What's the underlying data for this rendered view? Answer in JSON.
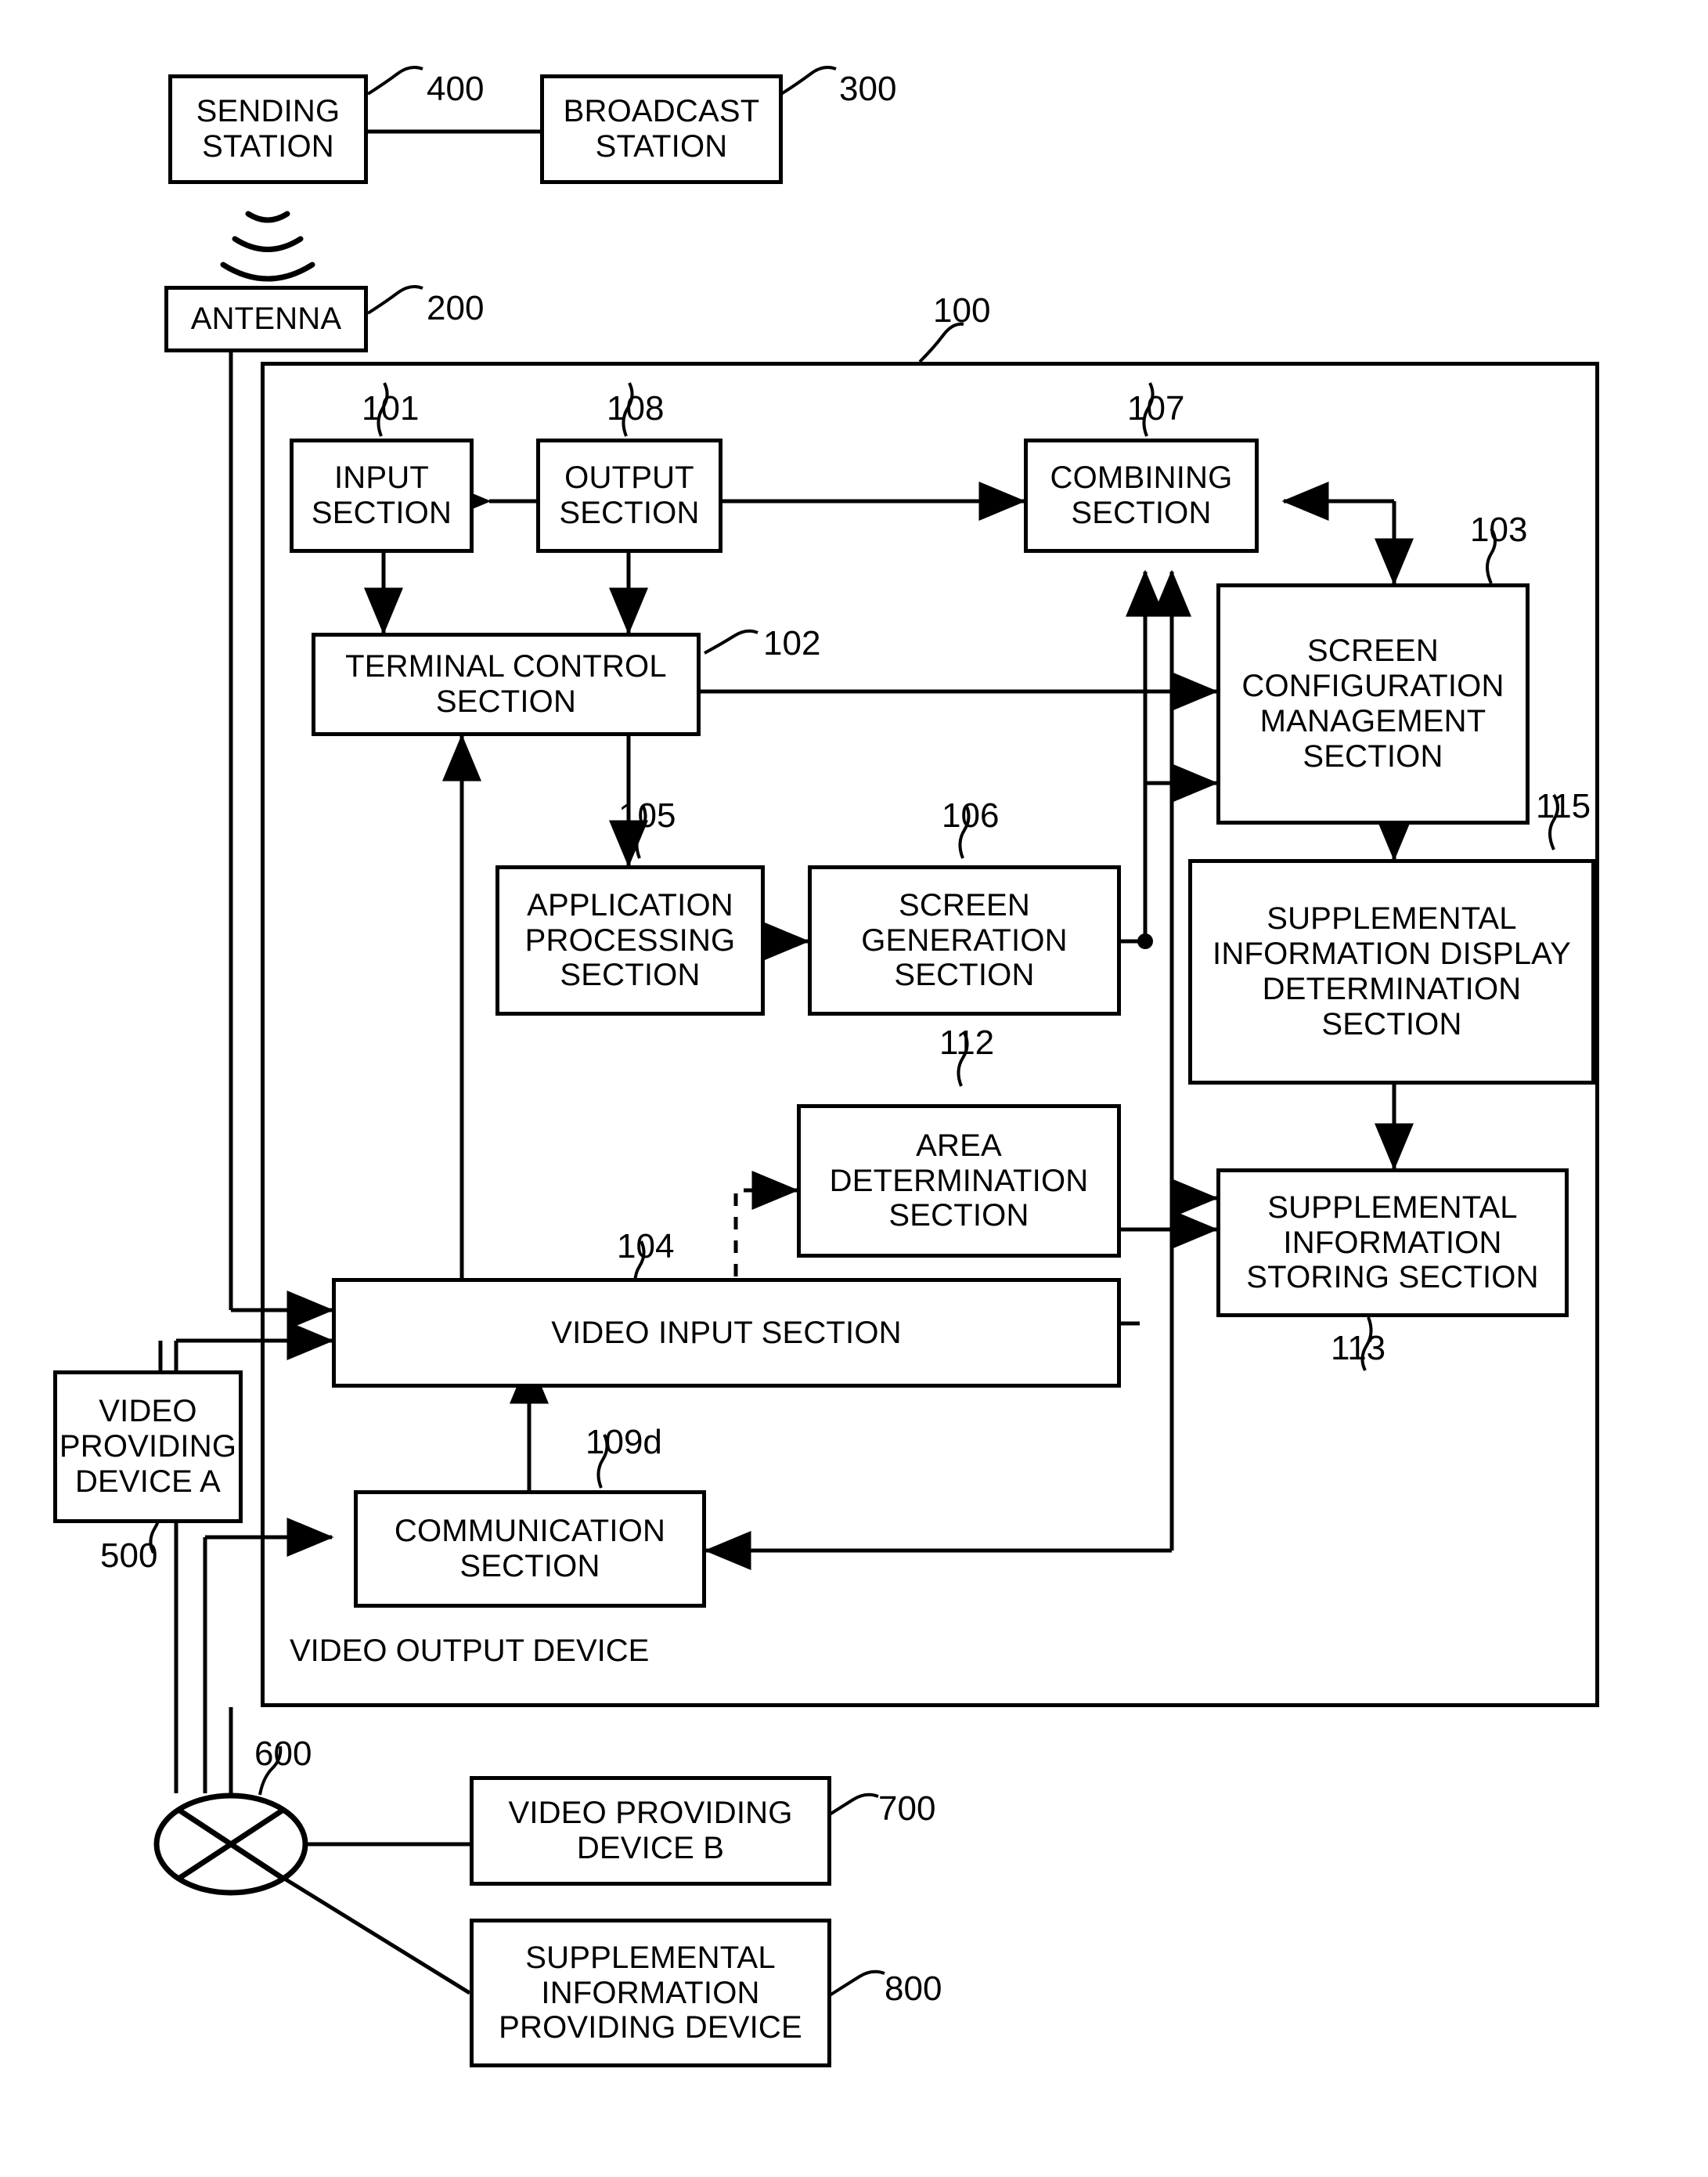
{
  "figure": {
    "type": "block-diagram",
    "domain": "patent-figure",
    "container_label": "VIDEO OUTPUT DEVICE",
    "container_ref": "100"
  },
  "blocks": [
    {
      "id": "sending_station",
      "label": "SENDING\nSTATION",
      "ref": "400"
    },
    {
      "id": "broadcast_station",
      "label": "BROADCAST\nSTATION",
      "ref": "300"
    },
    {
      "id": "antenna",
      "label": "ANTENNA",
      "ref": "200"
    },
    {
      "id": "input_section",
      "label": "INPUT\nSECTION",
      "ref": "101"
    },
    {
      "id": "output_section",
      "label": "OUTPUT\nSECTION",
      "ref": "108"
    },
    {
      "id": "combining_section",
      "label": "COMBINING\nSECTION",
      "ref": "107"
    },
    {
      "id": "screen_config",
      "label": "SCREEN\nCONFIGURATION\nMANAGEMENT\nSECTION",
      "ref": "103"
    },
    {
      "id": "terminal_control",
      "label": "TERMINAL CONTROL\nSECTION",
      "ref": "102"
    },
    {
      "id": "app_processing",
      "label": "APPLICATION\nPROCESSING\nSECTION",
      "ref": "105"
    },
    {
      "id": "screen_generation",
      "label": "SCREEN\nGENERATION\nSECTION",
      "ref": "106"
    },
    {
      "id": "supp_display_det",
      "label": "SUPPLEMENTAL\nINFORMATION DISPLAY\nDETERMINATION\nSECTION",
      "ref": "115"
    },
    {
      "id": "area_determination",
      "label": "AREA\nDETERMINATION\nSECTION",
      "ref": "112"
    },
    {
      "id": "supp_storing",
      "label": "SUPPLEMENTAL\nINFORMATION\nSTORING SECTION",
      "ref": "113"
    },
    {
      "id": "video_input",
      "label": "VIDEO INPUT SECTION",
      "ref": "104"
    },
    {
      "id": "video_provider_a",
      "label": "VIDEO\nPROVIDING\nDEVICE A",
      "ref": "500"
    },
    {
      "id": "communication",
      "label": "COMMUNICATION\nSECTION",
      "ref": "109d"
    },
    {
      "id": "network",
      "label": "",
      "ref": "600"
    },
    {
      "id": "video_provider_b",
      "label": "VIDEO PROVIDING\nDEVICE B",
      "ref": "700"
    },
    {
      "id": "supp_provider",
      "label": "SUPPLEMENTAL\nINFORMATION\nPROVIDING DEVICE",
      "ref": "800"
    }
  ],
  "refs": {
    "r100": "100",
    "r101": "101",
    "r102": "102",
    "r103": "103",
    "r104": "104",
    "r105": "105",
    "r106": "106",
    "r107": "107",
    "r108": "108",
    "r109d": "109d",
    "r112": "112",
    "r113": "113",
    "r115": "115",
    "r200": "200",
    "r300": "300",
    "r400": "400",
    "r500": "500",
    "r600": "600",
    "r700": "700",
    "r800": "800"
  },
  "labels": {
    "sending_station_l1": "SENDING",
    "sending_station_l2": "STATION",
    "broadcast_station_l1": "BROADCAST",
    "broadcast_station_l2": "STATION",
    "antenna": "ANTENNA",
    "input_section_l1": "INPUT",
    "input_section_l2": "SECTION",
    "output_section_l1": "OUTPUT",
    "output_section_l2": "SECTION",
    "combining_l1": "COMBINING",
    "combining_l2": "SECTION",
    "screen_config_l1": "SCREEN",
    "screen_config_l2": "CONFIGURATION",
    "screen_config_l3": "MANAGEMENT",
    "screen_config_l4": "SECTION",
    "terminal_control_l1": "TERMINAL CONTROL",
    "terminal_control_l2": "SECTION",
    "app_processing_l1": "APPLICATION",
    "app_processing_l2": "PROCESSING",
    "app_processing_l3": "SECTION",
    "screen_gen_l1": "SCREEN",
    "screen_gen_l2": "GENERATION",
    "screen_gen_l3": "SECTION",
    "supp_disp_l1": "SUPPLEMENTAL",
    "supp_disp_l2": "INFORMATION DISPLAY",
    "supp_disp_l3": "DETERMINATION",
    "supp_disp_l4": "SECTION",
    "area_det_l1": "AREA",
    "area_det_l2": "DETERMINATION",
    "area_det_l3": "SECTION",
    "supp_store_l1": "SUPPLEMENTAL",
    "supp_store_l2": "INFORMATION",
    "supp_store_l3": "STORING SECTION",
    "video_input": "VIDEO INPUT SECTION",
    "video_prov_a_l1": "VIDEO",
    "video_prov_a_l2": "PROVIDING",
    "video_prov_a_l3": "DEVICE A",
    "communication_l1": "COMMUNICATION",
    "communication_l2": "SECTION",
    "video_output_device": "VIDEO OUTPUT DEVICE",
    "video_prov_b_l1": "VIDEO PROVIDING",
    "video_prov_b_l2": "DEVICE B",
    "supp_prov_l1": "SUPPLEMENTAL",
    "supp_prov_l2": "INFORMATION",
    "supp_prov_l3": "PROVIDING DEVICE"
  }
}
